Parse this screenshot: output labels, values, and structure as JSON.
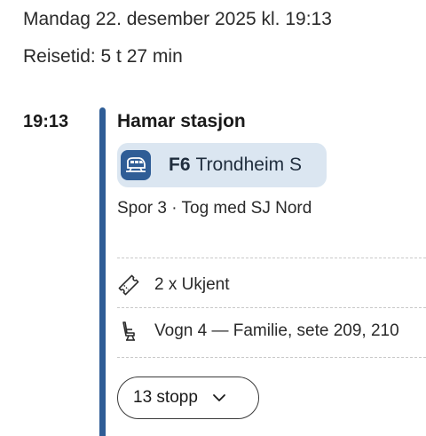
{
  "trip": {
    "date_line": "Mandag 22. desember 2025 kl. 19:13",
    "travel_time": "Reisetid: 5 t 27 min"
  },
  "leg": {
    "departure_time": "19:13",
    "station": "Hamar stasjon",
    "line": "F6",
    "destination": "Trondheim S",
    "platform_operator": "Spor 3 · Tog med SJ Nord",
    "tickets": "2 x Ukjent",
    "seats": "Vogn 4 — Familie, sete 209, 210",
    "stops_label": "13 stopp"
  },
  "colors": {
    "timeline": "#2f5d96",
    "chip_background": "#dbe6f1",
    "train_badge": "#2f5d96"
  },
  "icons": {
    "train": "train-icon",
    "ticket": "ticket-icon",
    "seat": "seat-icon",
    "chevron": "chevron-down-icon"
  }
}
